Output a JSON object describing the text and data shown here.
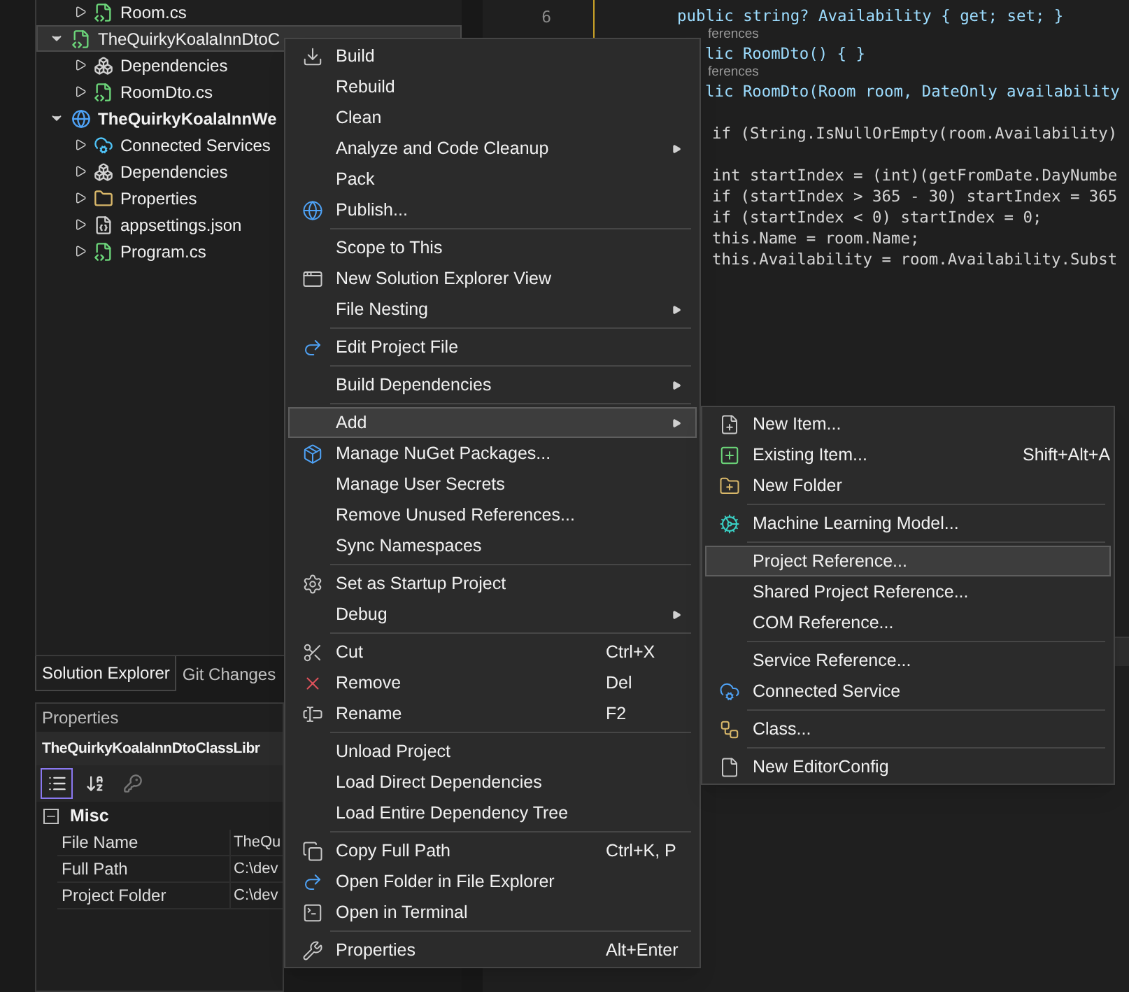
{
  "solution_explorer": {
    "continued_items": [
      {
        "label": "Room.cs",
        "kind": "cs_file",
        "expanded": false,
        "selected": false,
        "bold": false
      }
    ],
    "projects": [
      {
        "label": "TheQuirkyKoalaInnDtoC",
        "kind": "project",
        "expanded": true,
        "selected": true,
        "bold": false,
        "children": [
          {
            "label": "Dependencies",
            "kind": "dependencies",
            "expanded": false,
            "selected": false,
            "bold": false
          },
          {
            "label": "RoomDto.cs",
            "kind": "cs_file",
            "expanded": false,
            "selected": false,
            "bold": false
          }
        ]
      },
      {
        "label": "TheQuirkyKoalaInnWe",
        "kind": "web_project",
        "expanded": true,
        "selected": false,
        "bold": true,
        "children": [
          {
            "label": "Connected Services",
            "kind": "connected_services",
            "expanded": false,
            "selected": false,
            "bold": false
          },
          {
            "label": "Dependencies",
            "kind": "dependencies",
            "expanded": false,
            "selected": false,
            "bold": false
          },
          {
            "label": "Properties",
            "kind": "properties",
            "expanded": false,
            "selected": false,
            "bold": false
          },
          {
            "label": "appsettings.json",
            "kind": "json_file",
            "expanded": false,
            "selected": false,
            "bold": false
          },
          {
            "label": "Program.cs",
            "kind": "cs_file",
            "expanded": false,
            "selected": false,
            "bold": false
          }
        ]
      }
    ]
  },
  "panel_tabs": [
    {
      "label": "Solution Explorer",
      "selected": true
    },
    {
      "label": "Git Changes",
      "selected": false
    }
  ],
  "properties": {
    "title": "Properties",
    "object": "TheQuirkyKoalaInnDtoClassLibr",
    "toolbar": [
      {
        "kind": "categorized",
        "selected": true,
        "disabled": false
      },
      {
        "kind": "alphabetical",
        "selected": false,
        "disabled": false
      },
      {
        "kind": "property_pages",
        "selected": false,
        "disabled": true
      }
    ],
    "category": {
      "label": "Misc",
      "expanded": true
    },
    "rows": [
      {
        "name": "File Name",
        "value": "TheQu"
      },
      {
        "name": "Full Path",
        "value": "C:\\dev"
      },
      {
        "name": "Project Folder",
        "value": "C:\\dev"
      }
    ]
  },
  "editor": {
    "lines": [
      {
        "kind": "code",
        "number": "6",
        "text": "public string? Availability { get; set; }"
      },
      {
        "kind": "lens_cut",
        "text": "ferences"
      },
      {
        "kind": "code_cut",
        "text": "lic RoomDto() { }"
      },
      {
        "kind": "lens_cut",
        "text": "ferences"
      },
      {
        "kind": "code_cut",
        "text": "lic RoomDto(Room room, DateOnly availability"
      },
      {
        "kind": "blank"
      },
      {
        "kind": "body",
        "text": "if (String.IsNullOrEmpty(room.Availability)"
      },
      {
        "kind": "blank"
      },
      {
        "kind": "body",
        "text": "int startIndex = (int)(getFromDate.DayNumbe"
      },
      {
        "kind": "body",
        "text": "if (startIndex > 365 - 30) startIndex = 365"
      },
      {
        "kind": "body",
        "text": "if (startIndex < 0) startIndex = 0;"
      },
      {
        "kind": "body",
        "text": "this.Name = room.Name;"
      },
      {
        "kind": "body",
        "text": "this.Availability = room.Availability.Subst"
      }
    ]
  },
  "context_menu": {
    "items": [
      {
        "kind": "item",
        "label": "Build",
        "selected": false,
        "submenu": false
      },
      {
        "kind": "item",
        "label": "Rebuild",
        "selected": false,
        "submenu": false
      },
      {
        "kind": "item",
        "label": "Clean",
        "selected": false,
        "submenu": false
      },
      {
        "kind": "item",
        "label": "Analyze and Code Cleanup",
        "selected": false,
        "submenu": true
      },
      {
        "kind": "item",
        "label": "Pack",
        "selected": false,
        "submenu": false
      },
      {
        "kind": "item",
        "label": "Publish...",
        "selected": false,
        "submenu": false
      },
      {
        "kind": "separator"
      },
      {
        "kind": "item",
        "label": "Scope to This",
        "selected": false,
        "submenu": false
      },
      {
        "kind": "item",
        "label": "New Solution Explorer View",
        "selected": false,
        "submenu": false
      },
      {
        "kind": "item",
        "label": "File Nesting",
        "selected": false,
        "submenu": true
      },
      {
        "kind": "separator"
      },
      {
        "kind": "item",
        "label": "Edit Project File",
        "selected": false,
        "submenu": false
      },
      {
        "kind": "separator"
      },
      {
        "kind": "item",
        "label": "Build Dependencies",
        "selected": false,
        "submenu": true
      },
      {
        "kind": "separator"
      },
      {
        "kind": "item",
        "label": "Add",
        "selected": true,
        "submenu": true
      },
      {
        "kind": "item",
        "label": "Manage NuGet Packages...",
        "selected": false,
        "submenu": false
      },
      {
        "kind": "item",
        "label": "Manage User Secrets",
        "selected": false,
        "submenu": false
      },
      {
        "kind": "item",
        "label": "Remove Unused References...",
        "selected": false,
        "submenu": false
      },
      {
        "kind": "item",
        "label": "Sync Namespaces",
        "selected": false,
        "submenu": false
      },
      {
        "kind": "separator"
      },
      {
        "kind": "item",
        "label": "Set as Startup Project",
        "selected": false,
        "submenu": false
      },
      {
        "kind": "item",
        "label": "Debug",
        "selected": false,
        "submenu": true
      },
      {
        "kind": "separator"
      },
      {
        "kind": "item",
        "label": "Cut",
        "shortcut": "Ctrl+X",
        "selected": false,
        "submenu": false
      },
      {
        "kind": "item",
        "label": "Remove",
        "shortcut": "Del",
        "selected": false,
        "submenu": false
      },
      {
        "kind": "item",
        "label": "Rename",
        "shortcut": "F2",
        "selected": false,
        "submenu": false
      },
      {
        "kind": "separator"
      },
      {
        "kind": "item",
        "label": "Unload Project",
        "selected": false,
        "submenu": false
      },
      {
        "kind": "item",
        "label": "Load Direct Dependencies",
        "selected": false,
        "submenu": false
      },
      {
        "kind": "item",
        "label": "Load Entire Dependency Tree",
        "selected": false,
        "submenu": false
      },
      {
        "kind": "separator"
      },
      {
        "kind": "item",
        "label": "Copy Full Path",
        "shortcut": "Ctrl+K, P",
        "selected": false,
        "submenu": false
      },
      {
        "kind": "item",
        "label": "Open Folder in File Explorer",
        "selected": false,
        "submenu": false
      },
      {
        "kind": "item",
        "label": "Open in Terminal",
        "selected": false,
        "submenu": false
      },
      {
        "kind": "separator"
      },
      {
        "kind": "item",
        "label": "Properties",
        "shortcut": "Alt+Enter",
        "selected": false,
        "submenu": false
      }
    ]
  },
  "add_submenu": {
    "items": [
      {
        "kind": "item",
        "label": "New Item...",
        "selected": false
      },
      {
        "kind": "item",
        "label": "Existing Item...",
        "shortcut": "Shift+Alt+A",
        "selected": false
      },
      {
        "kind": "item",
        "label": "New Folder",
        "selected": false
      },
      {
        "kind": "separator"
      },
      {
        "kind": "item",
        "label": "Machine Learning Model...",
        "selected": false
      },
      {
        "kind": "separator"
      },
      {
        "kind": "item",
        "label": "Project Reference...",
        "selected": true
      },
      {
        "kind": "item",
        "label": "Shared Project Reference...",
        "selected": false
      },
      {
        "kind": "item",
        "label": "COM Reference...",
        "selected": false
      },
      {
        "kind": "separator"
      },
      {
        "kind": "item",
        "label": "Service Reference...",
        "selected": false
      },
      {
        "kind": "item",
        "label": "Connected Service",
        "selected": false
      },
      {
        "kind": "separator"
      },
      {
        "kind": "item",
        "label": "Class...",
        "selected": false
      },
      {
        "kind": "separator"
      },
      {
        "kind": "item",
        "label": "New EditorConfig",
        "selected": false
      }
    ]
  }
}
